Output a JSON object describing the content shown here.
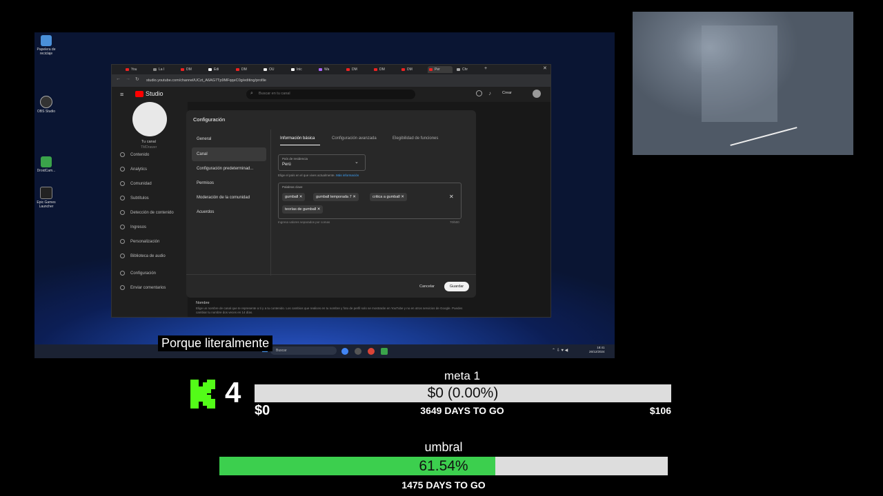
{
  "desktop": {
    "icons": [
      {
        "label": "Papelera de reciclaje",
        "icon": "recycle-bin-icon",
        "color": "#4a90d9"
      },
      {
        "label": "OBS Studio",
        "icon": "obs-icon",
        "color": "#333333"
      },
      {
        "label": "DroidCam...",
        "icon": "droidcam-icon",
        "color": "#3aa34a"
      },
      {
        "label": "Epic Games Launcher",
        "icon": "epic-games-icon",
        "color": "#222222"
      }
    ],
    "taskbar": {
      "search_placeholder": "Buscar",
      "clock_time": "18:41",
      "clock_date": "26/12/2024"
    }
  },
  "browser": {
    "tabs": [
      "You",
      "La I",
      "DM",
      "Edi",
      "DM",
      "OU",
      "Inic",
      "Wa",
      "DM",
      "DM",
      "DM",
      "Per",
      "Chr"
    ],
    "active_tab_index": 11,
    "url": "studio.youtube.com/channel/UCzt_A6AG7Tp9MFqqeC0g/editing/profile"
  },
  "youtube": {
    "logo_text": "Studio",
    "search_placeholder": "Buscar en tu canal",
    "create_label": "Crear",
    "channel_label": "Tu canal",
    "channel_name": "TMDrawer",
    "sidebar": [
      {
        "label": "Contenido",
        "icon": "content-icon"
      },
      {
        "label": "Analytics",
        "icon": "analytics-icon"
      },
      {
        "label": "Comunidad",
        "icon": "community-icon"
      },
      {
        "label": "Subtítulos",
        "icon": "subtitles-icon"
      },
      {
        "label": "Detección de contenido",
        "icon": "copyright-icon"
      },
      {
        "label": "Ingresos",
        "icon": "earn-icon"
      },
      {
        "label": "Personalización",
        "icon": "customization-icon"
      },
      {
        "label": "Biblioteca de audio",
        "icon": "audio-library-icon"
      },
      {
        "label": "Configuración",
        "icon": "settings-icon"
      },
      {
        "label": "Enviar comentarios",
        "icon": "feedback-icon"
      }
    ],
    "bg_name_label": "Nombre",
    "bg_name_help": "Elige un nombre de canal que te represente a ti y a tu contenido. Los cambios que realices en tu nombre y foto de perfil solo se mostrarán en YouTube y no en otros servicios de Google. Puedes cambiar tu nombre dos veces en 14 días."
  },
  "dialog": {
    "title": "Configuración",
    "sidebar": [
      "General",
      "Canal",
      "Configuración predeterminad...",
      "Permisos",
      "Moderación de la comunidad",
      "Acuerdos"
    ],
    "active_side": 1,
    "tabs": [
      "Información básica",
      "Configuración avanzada",
      "Elegibilidad de funciones"
    ],
    "active_tab": 0,
    "country_label": "País de residencia",
    "country_value": "Perú",
    "country_help": "Elige el país en el que vives actualmente.",
    "more_info": "Más información",
    "keywords_label": "Palabras clave",
    "keywords": [
      "gumball",
      "gumball temporada 7",
      "critica a gumball",
      "teorías de gumball"
    ],
    "keywords_help": "Ingresa valores separados por comas",
    "keywords_count": "70/500",
    "cancel_label": "Cancelar",
    "save_label": "Guardar"
  },
  "subtitle": "Porque literalmente",
  "goal1": {
    "logo": "kick-logo",
    "logo_color": "#53fc18",
    "count": "4",
    "title": "meta 1",
    "bar_text": "$0 (0.00%)",
    "progress": 0.0,
    "left_label": "$0",
    "days_label": "3649 DAYS TO GO",
    "right_label": "$106"
  },
  "goal2": {
    "title": "umbral",
    "bar_text": "61.54%",
    "progress": 0.6154,
    "fill_color": "#3ccf4e",
    "days_label": "1475 DAYS TO GO"
  }
}
